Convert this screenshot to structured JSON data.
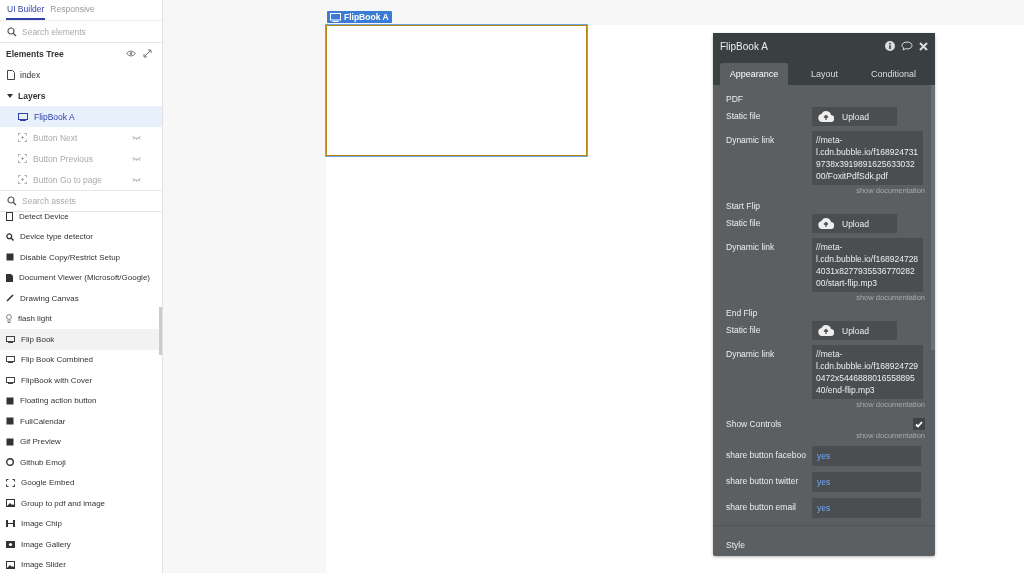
{
  "sidebar": {
    "tabs": [
      {
        "label": "UI Builder",
        "selected": true
      },
      {
        "label": "Responsive",
        "selected": false
      }
    ],
    "search": {
      "placeholder": "Search elements"
    },
    "tree": {
      "title": "Elements Tree",
      "page": "index",
      "layers": {
        "label": "Layers",
        "expanded": true,
        "children": [
          {
            "label": "FlipBook A",
            "selected": true,
            "hidden": false
          },
          {
            "label": "Button Next",
            "selected": false,
            "hidden": true
          },
          {
            "label": "Button Previous",
            "selected": false,
            "hidden": true
          },
          {
            "label": "Button Go to page",
            "selected": false,
            "hidden": true
          }
        ]
      }
    }
  },
  "assets_search": {
    "placeholder": "Search assets"
  },
  "assets": [
    {
      "label": "Detect Device",
      "selected": false
    },
    {
      "label": "Device type detector",
      "selected": false
    },
    {
      "label": "Disable Copy/Restrict Setup",
      "selected": false
    },
    {
      "label": "Document Viewer (Microsoft/Google)",
      "selected": false
    },
    {
      "label": "Drawing Canvas",
      "selected": false
    },
    {
      "label": "flash light",
      "selected": false
    },
    {
      "label": "Flip Book",
      "selected": true
    },
    {
      "label": "Flip Book Combined",
      "selected": false
    },
    {
      "label": "FlipBook with Cover",
      "selected": false
    },
    {
      "label": "Floating action button",
      "selected": false
    },
    {
      "label": "FullCalendar",
      "selected": false
    },
    {
      "label": "Gif Preview",
      "selected": false
    },
    {
      "label": "Github Emoji",
      "selected": false
    },
    {
      "label": "Google Embed",
      "selected": false
    },
    {
      "label": "Group to pdf and image",
      "selected": false
    },
    {
      "label": "Image Chip",
      "selected": false
    },
    {
      "label": "Image Gallery",
      "selected": false
    },
    {
      "label": "Image Slider",
      "selected": false
    }
  ],
  "canvas": {
    "element_tag": "FlipBook A"
  },
  "property_panel": {
    "title": "FlipBook A",
    "tabs": [
      {
        "label": "Appearance",
        "selected": true
      },
      {
        "label": "Layout",
        "selected": false
      },
      {
        "label": "Conditional",
        "selected": false
      }
    ],
    "file_groups": [
      {
        "title": "PDF",
        "static_label": "Static file",
        "upload": "Upload",
        "dynamic_label": "Dynamic link",
        "dynamic_value": "//meta-l.cdn.bubble.io/f1689247319738x391989162563303200/FoxitPdfSdk.pdf",
        "doc": "show documentation"
      },
      {
        "title": "Start Flip",
        "static_label": "Static file",
        "upload": "Upload",
        "dynamic_label": "Dynamic link",
        "dynamic_value": "//meta-l.cdn.bubble.io/f1689247284031x827793553677028200/start-flip.mp3",
        "doc": "show documentation"
      },
      {
        "title": "End Flip",
        "static_label": "Static file",
        "upload": "Upload",
        "dynamic_label": "Dynamic link",
        "dynamic_value": "//meta-l.cdn.bubble.io/f1689247290472x544688801655889540/end-flip.mp3",
        "doc": "show documentation"
      }
    ],
    "show_controls": {
      "label": "Show Controls",
      "checked": true,
      "doc": "show documentation"
    },
    "fields": [
      {
        "label": "share button faceboo",
        "value": "yes"
      },
      {
        "label": "share button twitter",
        "value": "yes"
      },
      {
        "label": "share button email",
        "value": "yes"
      }
    ],
    "style_label": "Style"
  }
}
